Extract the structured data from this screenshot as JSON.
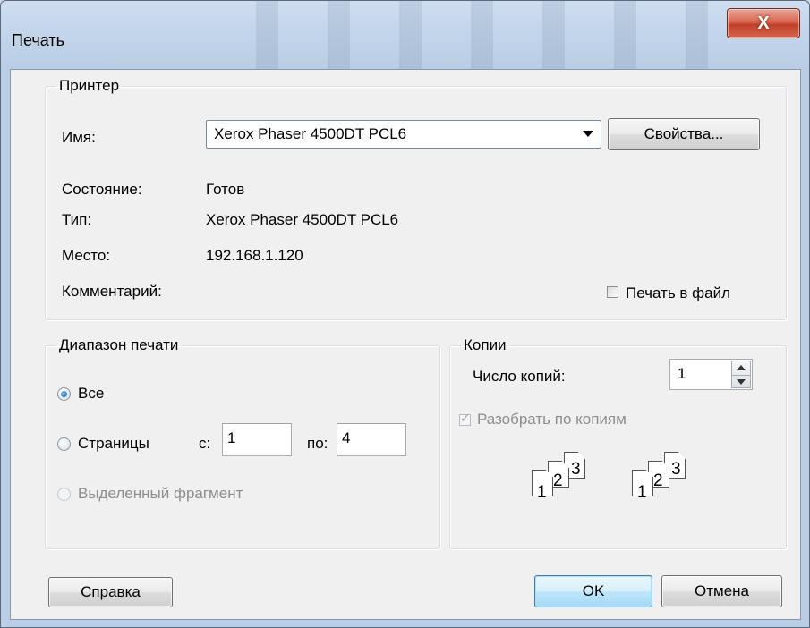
{
  "window": {
    "title": "Печать",
    "close_glyph": "X"
  },
  "printer": {
    "group_label": "Принтер",
    "name_label": "Имя:",
    "name_value": "Xerox Phaser 4500DT PCL6",
    "properties_button": "Свойства...",
    "status_label": "Состояние:",
    "status_value": "Готов",
    "type_label": "Тип:",
    "type_value": "Xerox Phaser 4500DT PCL6",
    "location_label": "Место:",
    "location_value": "192.168.1.120",
    "comment_label": "Комментарий:",
    "print_to_file_label": "Печать в файл",
    "print_to_file_checked": false
  },
  "range": {
    "group_label": "Диапазон печати",
    "all_label": "Все",
    "all_selected": true,
    "pages_label": "Страницы",
    "from_label": "с:",
    "from_value": "1",
    "to_label": "по:",
    "to_value": "4",
    "selection_label": "Выделенный фрагмент"
  },
  "copies": {
    "group_label": "Копии",
    "count_label": "Число копий:",
    "count_value": "1",
    "collate_label": "Разобрать по копиям",
    "collate_checked": true,
    "collate_pages": [
      "1",
      "2",
      "3",
      "1",
      "2",
      "3"
    ]
  },
  "buttons": {
    "help": "Справка",
    "ok": "OK",
    "cancel": "Отмена"
  },
  "icons": {
    "close": "close-icon",
    "dropdown": "chevron-down-icon",
    "spin_up": "arrow-up-icon",
    "spin_down": "arrow-down-icon",
    "collate": "collate-pages-icon"
  }
}
